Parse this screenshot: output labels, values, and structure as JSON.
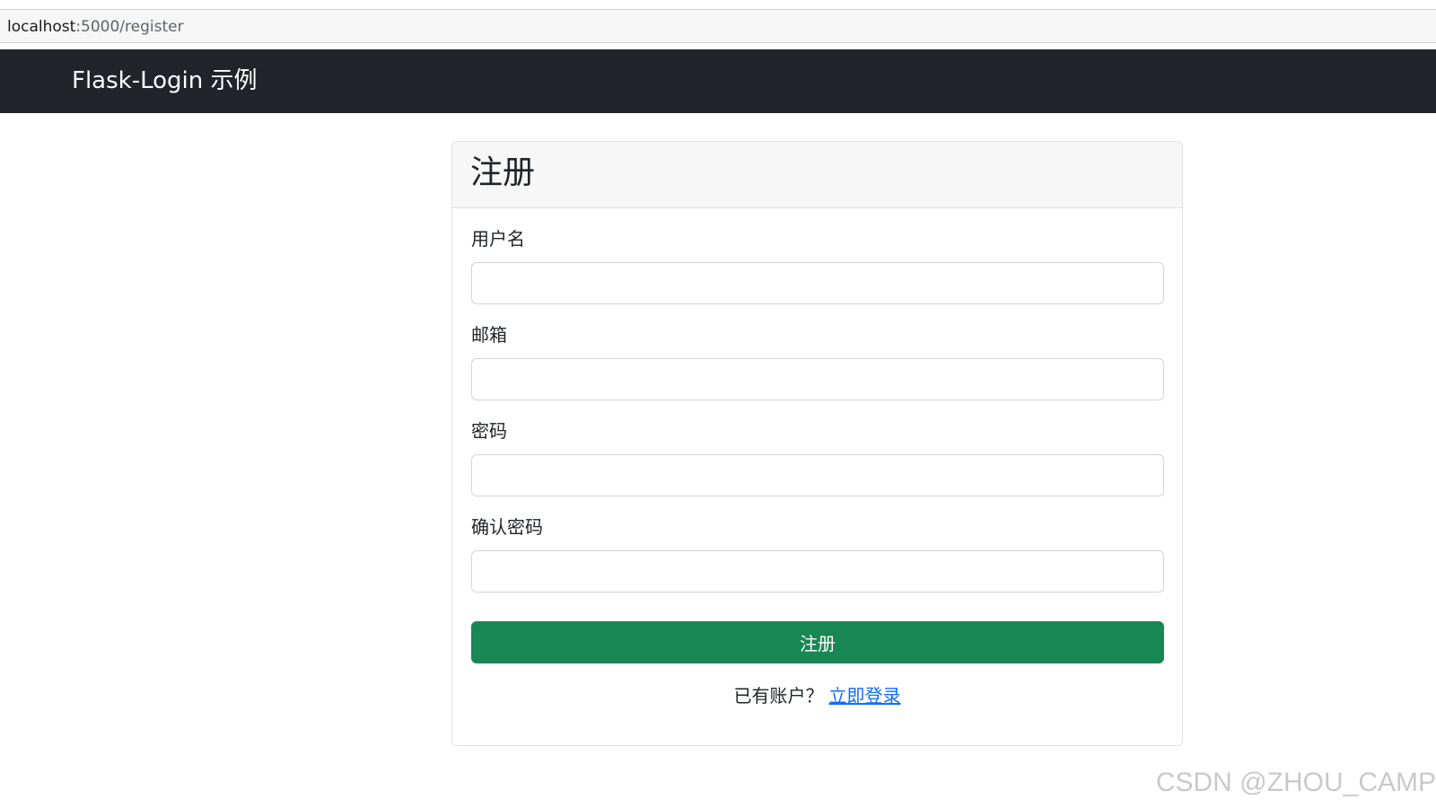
{
  "browser": {
    "url_host": "localhost",
    "url_rest": ":5000/register"
  },
  "navbar": {
    "brand": "Flask-Login 示例"
  },
  "register_card": {
    "title": "注册",
    "fields": [
      {
        "label": "用户名",
        "value": ""
      },
      {
        "label": "邮箱",
        "value": ""
      },
      {
        "label": "密码",
        "value": ""
      },
      {
        "label": "确认密码",
        "value": ""
      }
    ],
    "submit_label": "注册",
    "login_prompt": "已有账户？",
    "login_link": "立即登录"
  },
  "watermark": "CSDN @ZHOU_CAMP",
  "colors": {
    "navbar_bg": "#212529",
    "submit_bg": "#198754",
    "link": "#0d6efd"
  }
}
